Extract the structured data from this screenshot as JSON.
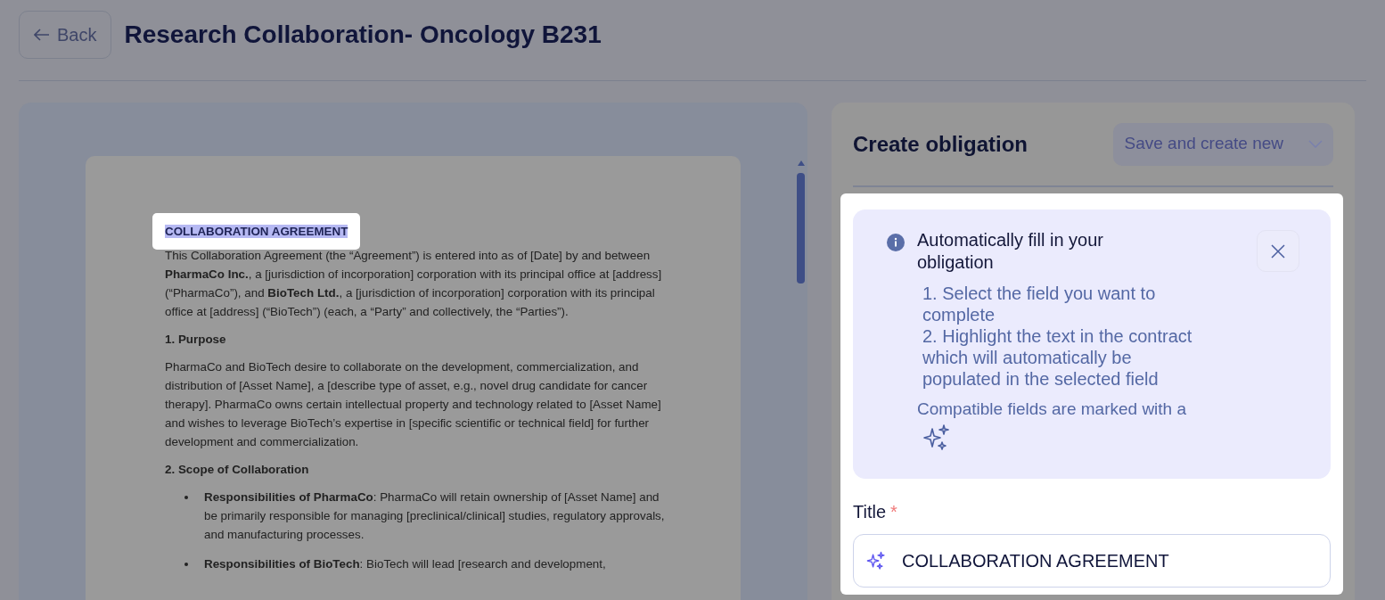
{
  "header": {
    "back_button": {
      "label": "Back"
    },
    "title": "Research Collaboration- Oncology B231"
  },
  "document": {
    "blocks": [
      {
        "kind": "heading",
        "text": "COLLABORATION AGREEMENT",
        "highlighted": true
      },
      {
        "kind": "paragraph",
        "text": "This Collaboration Agreement (the “Agreement”) is entered into as of [Date] by and between **PharmaCo Inc.**, a [jurisdiction of incorporation] corporation with its principal office at [address] (“PharmaCo”), and **BioTech Ltd.**, a [jurisdiction of incorporation] corporation with its principal office at [address] (“BioTech”) (each, a “Party” and collectively, the “Parties”)."
      },
      {
        "kind": "section",
        "text": "1. Purpose"
      },
      {
        "kind": "paragraph",
        "text": "PharmaCo and BioTech desire to collaborate on the development, commercialization, and distribution of [Asset Name], a [describe type of asset, e.g., novel drug candidate for cancer therapy]. PharmaCo owns certain intellectual property and technology related to [Asset Name] and wishes to leverage BioTech’s expertise in [specific scientific or technical field] for further development and commercialization."
      },
      {
        "kind": "section",
        "text": "2. Scope of Collaboration"
      },
      {
        "kind": "bullet",
        "text": "**Responsibilities of PharmaCo**: PharmaCo will retain ownership of [Asset Name] and be primarily responsible for managing [preclinical/clinical] studies, regulatory approvals, and manufacturing processes."
      },
      {
        "kind": "bullet",
        "text": "**Responsibilities of BioTech**: BioTech will lead [research and development,"
      }
    ]
  },
  "panel": {
    "title": "Create obligation",
    "save_button": {
      "label": "Save and create new",
      "disabled": true
    },
    "hint": {
      "title": "Automatically fill in your obligation",
      "steps": [
        "1. Select the field you want to complete",
        "2. Highlight the text in the contract which will automatically be populated in the selected field"
      ],
      "note": "Compatible fields are marked with a"
    },
    "title_field": {
      "label": "Title",
      "required": true,
      "required_mark": "*",
      "value": "COLLABORATION AGREEMENT"
    }
  }
}
